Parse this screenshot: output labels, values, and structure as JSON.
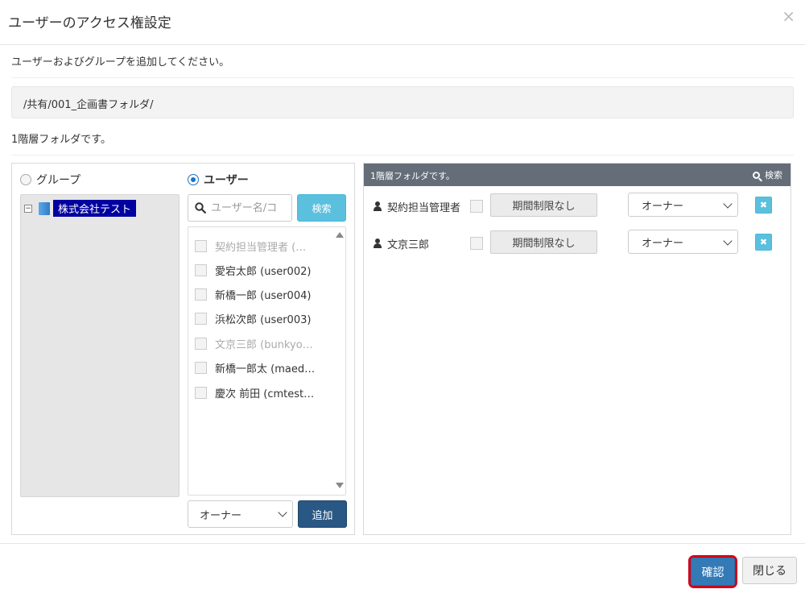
{
  "dialog": {
    "title": "ユーザーのアクセス権設定",
    "close_glyph": "×",
    "instruction": "ユーザーおよびグループを追加してください。",
    "path": "/共有/001_企画書フォルダ/",
    "folder_desc": "1階層フォルダです。"
  },
  "left": {
    "radio_group_label": "グループ",
    "radio_user_label": "ユーザー",
    "selected_mode": "user",
    "tree": {
      "toggle_glyph": "−",
      "root_label": "株式会社テスト"
    },
    "search": {
      "placeholder": "ユーザー名/コ",
      "button_label": "検索"
    },
    "users": [
      {
        "name": "契約担当管理者 (…",
        "disabled": true
      },
      {
        "name": "愛宕太郎 (user002)",
        "disabled": false
      },
      {
        "name": "新橋一郎 (user004)",
        "disabled": false
      },
      {
        "name": "浜松次郎 (user003)",
        "disabled": false
      },
      {
        "name": "文京三郎 (bunkyo…",
        "disabled": true
      },
      {
        "name": "新橋一郎太 (maed…",
        "disabled": false
      },
      {
        "name": "慶次 前田 (cmtest…",
        "disabled": false
      }
    ],
    "role_select_value": "オーナー",
    "add_button_label": "追加"
  },
  "right": {
    "header_title": "1階層フォルダです。",
    "header_search_label": "検索",
    "permissions": [
      {
        "name": "契約担当管理者",
        "period_label": "期間制限なし",
        "role": "オーナー",
        "remove_glyph": "✖"
      },
      {
        "name": "文京三郎",
        "period_label": "期間制限なし",
        "role": "オーナー",
        "remove_glyph": "✖"
      }
    ]
  },
  "footer": {
    "confirm_label": "確認",
    "close_label": "閉じる"
  },
  "colors": {
    "accent_blue": "#337ab7",
    "info_blue": "#5bc0de",
    "dark_blue": "#2a5885",
    "panel_header": "#646d78",
    "highlight_ring": "#d0021b",
    "tree_selected": "#0000a0"
  }
}
